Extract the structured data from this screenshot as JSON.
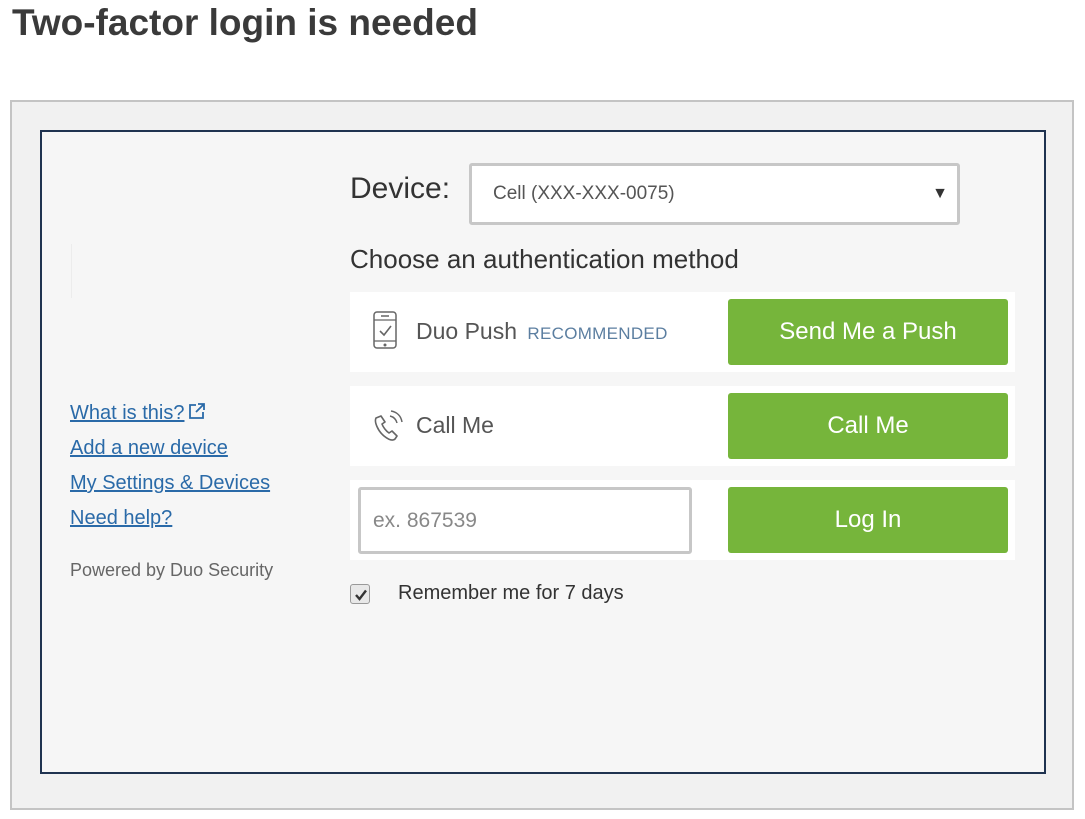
{
  "page": {
    "title": "Two-factor login is needed"
  },
  "sidebar": {
    "links": [
      {
        "label": "What is this?"
      },
      {
        "label": "Add a new device"
      },
      {
        "label": "My Settings & Devices"
      },
      {
        "label": "Need help?"
      }
    ],
    "powered_by": "Powered by Duo Security"
  },
  "device": {
    "label": "Device:",
    "selected": "Cell (XXX-XXX-0075)"
  },
  "methods": {
    "heading": "Choose an authentication method",
    "push": {
      "icon": "phone-push-icon",
      "label": "Duo Push",
      "badge": "RECOMMENDED",
      "button": "Send Me a Push"
    },
    "call": {
      "icon": "phone-call-icon",
      "label": "Call Me",
      "button": "Call Me"
    },
    "passcode": {
      "placeholder": "ex. 867539",
      "value": "",
      "button": "Log In"
    }
  },
  "remember": {
    "label": "Remember me for 7 days",
    "checked": true
  },
  "colors": {
    "accent_green": "#76b53b",
    "link_blue": "#2a6aa8",
    "frame_border": "#1f3350"
  }
}
